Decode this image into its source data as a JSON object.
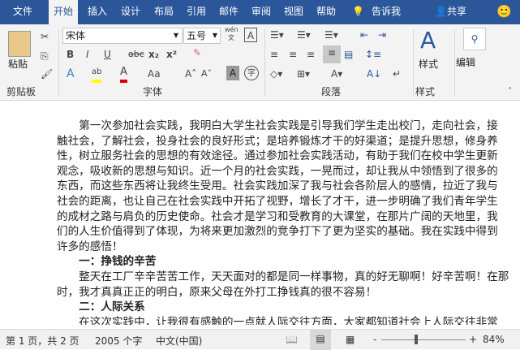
{
  "tabs": [
    "文件",
    "开始",
    "插入",
    "设计",
    "布局",
    "引用",
    "邮件",
    "审阅",
    "视图",
    "帮助",
    "告诉我",
    "共享"
  ],
  "active_tab": "开始",
  "ribbon": {
    "paste": "粘贴",
    "font_name": "宋体",
    "font_size": "五号",
    "groups": {
      "clipboard": "剪贴板",
      "font": "字体",
      "paragraph": "段落",
      "styles": "样式"
    },
    "styles_button": "样式",
    "edit_button": "编辑",
    "font_buttons": [
      "B",
      "I",
      "U",
      "abc",
      "x₂",
      "x²"
    ],
    "case_button": "Aa",
    "wen": "wén文"
  },
  "document": {
    "lines": [
      "　　第一次参加社会实践，我明白大学生社会实践是引导我们学生走出校门，走向社会，接",
      "触社会，了解社会，投身社会的良好形式；是培养锻炼才干的好渠道；是提升思想，修身养",
      "性，树立服务社会的思想的有效途径。通过参加社会实践活动，有助于我们在校中学生更新",
      "观念，吸收新的思想与知识。近一个月的社会实践，一晃而过，却让我从中领悟到了很多的",
      "东西，而这些东西将让我终生受用。社会实践加深了我与社会各阶层人的感情，拉近了我与",
      "社会的距离，也让自己在社会实践中开拓了视野，增长了才干，进一步明确了我们青年学生",
      "的成材之路与肩负的历史使命。社会才是学习和受教育的大课堂，在那片广阔的天地里，我",
      "们的人生价值得到了体现，为将来更加激烈的竞争打下了更为坚实的基础。我在实践中得到",
      "许多的感悟！",
      "　　一：挣钱的辛苦",
      "　　整天在工厂辛辛苦苦工作，天天面对的都是同一样事物，真的好无聊啊！好辛苦啊！在那",
      "时，我才真真正正的明白，原来父母在外打工挣钱真的很不容易！",
      "　　二：人际关系",
      "　　在这次实践中，让我很有感触的一点就人际交往方面，大家都知道社会上人际交往非常"
    ],
    "headings": [
      9,
      12
    ],
    "last_lines": [
      8,
      9,
      11,
      12
    ]
  },
  "status": {
    "page": "第 1 页，共 2 页",
    "words": "2005 个字",
    "language": "中文(中国)",
    "zoom": "84%",
    "zoom_level": 84
  },
  "colors": {
    "tabbar": "#2b579a",
    "highlight": "#ffff00",
    "font_color": "#e00000"
  }
}
